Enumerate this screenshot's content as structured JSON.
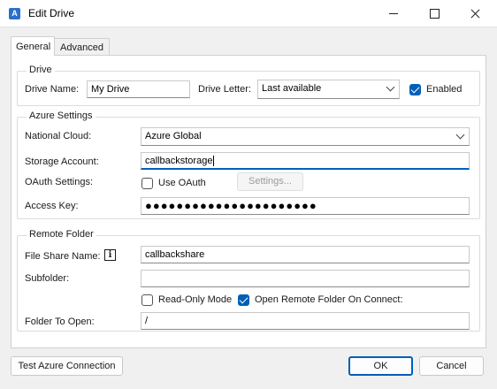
{
  "window": {
    "title": "Edit Drive"
  },
  "tabs": [
    "General",
    "Advanced"
  ],
  "drive": {
    "group_label": "Drive",
    "name_label": "Drive Name:",
    "name_value": "My Drive",
    "letter_label": "Drive Letter:",
    "letter_value": "Last available",
    "enabled_label": "Enabled",
    "enabled_checked": true
  },
  "azure": {
    "group_label": "Azure Settings",
    "cloud_label": "National Cloud:",
    "cloud_value": "Azure Global",
    "account_label": "Storage Account:",
    "account_value": "callbackstorage",
    "oauth_label": "OAuth Settings:",
    "use_oauth_label": "Use OAuth",
    "use_oauth_checked": false,
    "settings_button": "Settings...",
    "key_label": "Access Key:",
    "key_value": "●●●●●●●●●●●●●●●●●●●●●●"
  },
  "remote": {
    "group_label": "Remote Folder",
    "share_label": "File Share Name:",
    "share_value": "callbackshare",
    "subfolder_label": "Subfolder:",
    "subfolder_value": "",
    "readonly_label": "Read-Only Mode",
    "readonly_checked": false,
    "open_on_connect_label": "Open Remote Folder On Connect:",
    "open_on_connect_checked": true,
    "folder_open_label": "Folder To Open:",
    "folder_open_value": "/"
  },
  "footer": {
    "test_button": "Test Azure Connection",
    "ok_button": "OK",
    "cancel_button": "Cancel"
  },
  "colors": {
    "accent": "#005fb8"
  }
}
